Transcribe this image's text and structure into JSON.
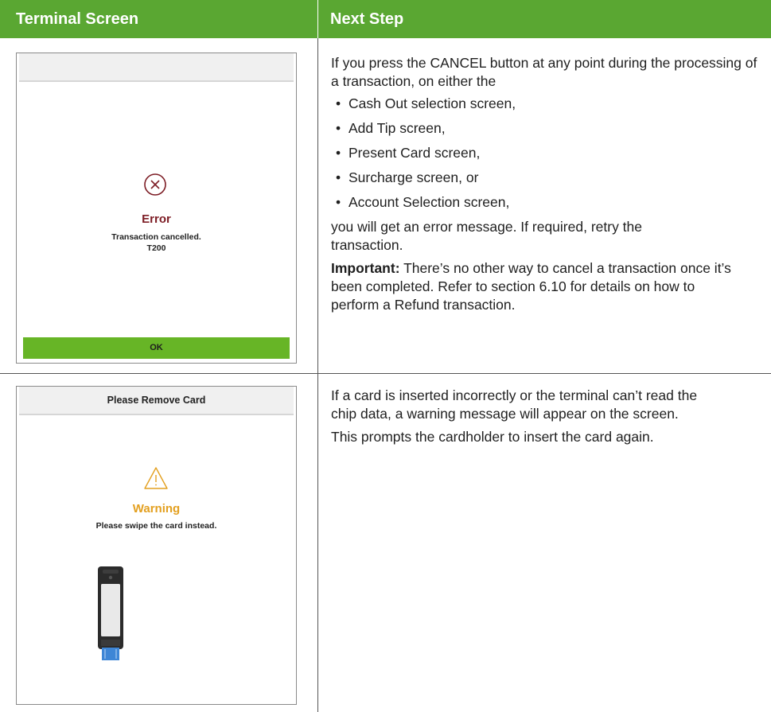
{
  "header": {
    "col1": "Terminal Screen",
    "col2": "Next Step"
  },
  "row1": {
    "screen": {
      "bar_title": "",
      "title": "Error",
      "message_line1": "Transaction cancelled.",
      "message_line2": "T200",
      "button": "OK",
      "icon": "cancel-circle-icon"
    },
    "step": {
      "intro": "If you press the CANCEL button at any point during the processing of a transaction, on either the",
      "bullets": [
        "Cash Out selection screen,",
        "Add Tip screen,",
        "Present Card screen,",
        "Surcharge screen, or",
        "Account Selection screen,"
      ],
      "after": "you will get an error message. If required, retry the transaction.",
      "important_label": "Important:",
      "important_text": "There’s no other way to cancel a transaction once it’s been completed. Refer to section 6.10 for details on how to perform a Refund transaction."
    }
  },
  "row2": {
    "screen": {
      "bar_title": "Please Remove Card",
      "title": "Warning",
      "message": "Please swipe the card instead.",
      "icon": "warning-triangle-icon",
      "image": "terminal-device-with-card-image"
    },
    "step": {
      "paragraph1": "If a card is inserted incorrectly or the terminal can’t read the chip data, a warning message will appear on the screen.",
      "paragraph2": "This prompts the cardholder to insert the card again."
    }
  },
  "colors": {
    "header_green": "#5aa732",
    "ok_green": "#67b526",
    "error_red": "#7d1d25",
    "warning_amber": "#e3a020"
  }
}
